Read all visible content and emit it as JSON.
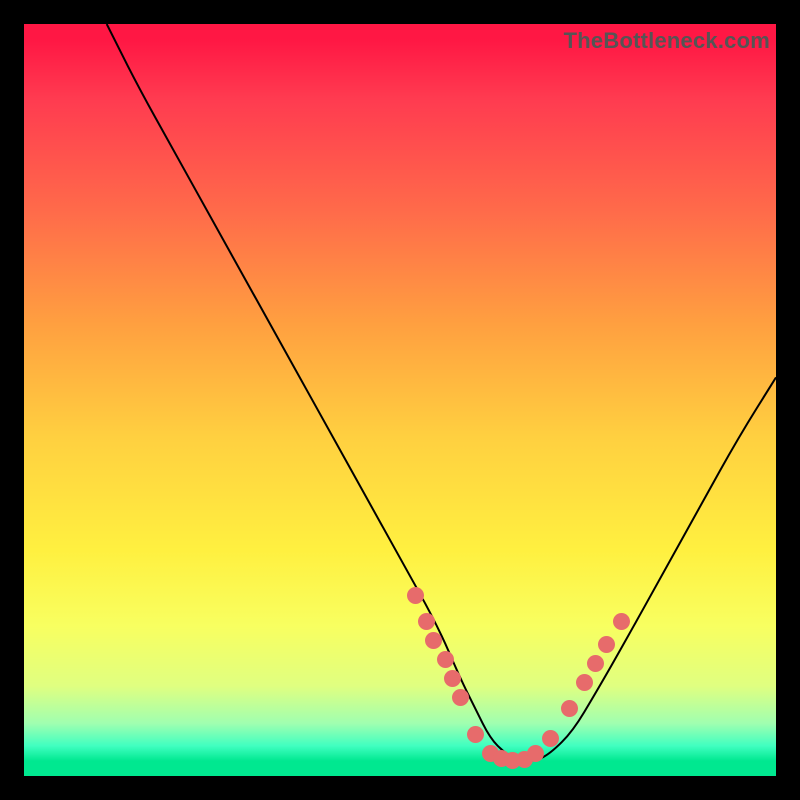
{
  "watermark": "TheBottleneck.com",
  "chart_data": {
    "type": "line",
    "title": "",
    "xlabel": "",
    "ylabel": "",
    "xlim": [
      0,
      100
    ],
    "ylim": [
      0,
      100
    ],
    "grid": false,
    "legend": false,
    "series": [
      {
        "name": "curve",
        "x": [
          11,
          15,
          20,
          25,
          30,
          35,
          40,
          45,
          50,
          55,
          58,
          60,
          62,
          64,
          66,
          68,
          70,
          73,
          76,
          80,
          85,
          90,
          95,
          100
        ],
        "y": [
          100,
          92,
          83,
          74,
          65,
          56,
          47,
          38,
          29,
          20,
          13,
          9,
          5,
          3,
          2,
          2,
          3,
          6,
          11,
          18,
          27,
          36,
          45,
          53
        ]
      }
    ],
    "markers": [
      {
        "x": 52.0,
        "y": 24.0
      },
      {
        "x": 53.5,
        "y": 20.5
      },
      {
        "x": 54.5,
        "y": 18.0
      },
      {
        "x": 56.0,
        "y": 15.5
      },
      {
        "x": 57.0,
        "y": 13.0
      },
      {
        "x": 58.0,
        "y": 10.5
      },
      {
        "x": 60.0,
        "y": 5.5
      },
      {
        "x": 62.0,
        "y": 3.0
      },
      {
        "x": 63.5,
        "y": 2.3
      },
      {
        "x": 65.0,
        "y": 2.0
      },
      {
        "x": 66.5,
        "y": 2.2
      },
      {
        "x": 68.0,
        "y": 3.0
      },
      {
        "x": 70.0,
        "y": 5.0
      },
      {
        "x": 72.5,
        "y": 9.0
      },
      {
        "x": 74.5,
        "y": 12.5
      },
      {
        "x": 76.0,
        "y": 15.0
      },
      {
        "x": 77.5,
        "y": 17.5
      },
      {
        "x": 79.5,
        "y": 20.5
      }
    ],
    "colors": {
      "curve": "#000000",
      "markers": "#e76b6b"
    }
  }
}
